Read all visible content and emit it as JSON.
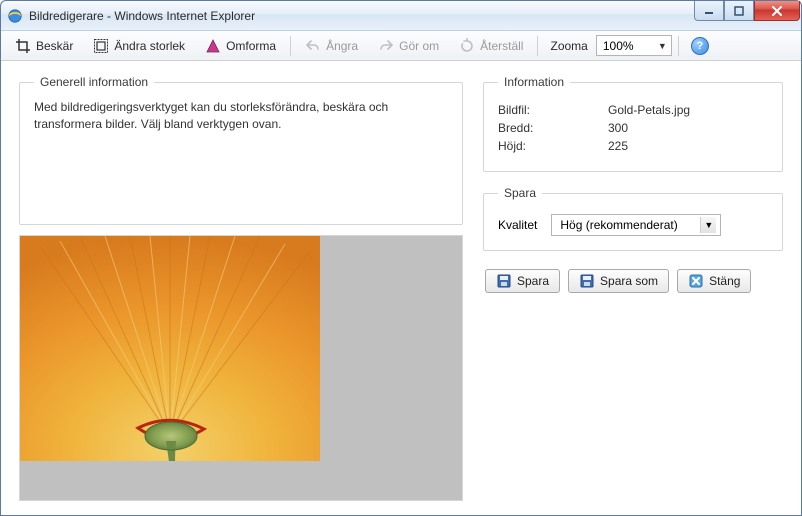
{
  "window": {
    "title": "Bildredigerare - Windows Internet Explorer"
  },
  "toolbar": {
    "crop": "Beskär",
    "resize": "Ändra storlek",
    "transform": "Omforma",
    "undo": "Ångra",
    "redo": "Gör om",
    "reset": "Återställ",
    "zoom_label": "Zooma",
    "zoom_value": "100%"
  },
  "general": {
    "legend": "Generell information",
    "text": "Med bildredigeringsverktyget kan du storleksförändra, beskära och transformera bilder. Välj bland verktygen ovan."
  },
  "info": {
    "legend": "Information",
    "file_label": "Bildfil:",
    "file_value": "Gold-Petals.jpg",
    "width_label": "Bredd:",
    "width_value": "300",
    "height_label": "Höjd:",
    "height_value": "225"
  },
  "save_group": {
    "legend": "Spara",
    "quality_label": "Kvalitet",
    "quality_value": "Hög (rekommenderat)"
  },
  "buttons": {
    "save": "Spara",
    "save_as": "Spara som",
    "close": "Stäng"
  }
}
